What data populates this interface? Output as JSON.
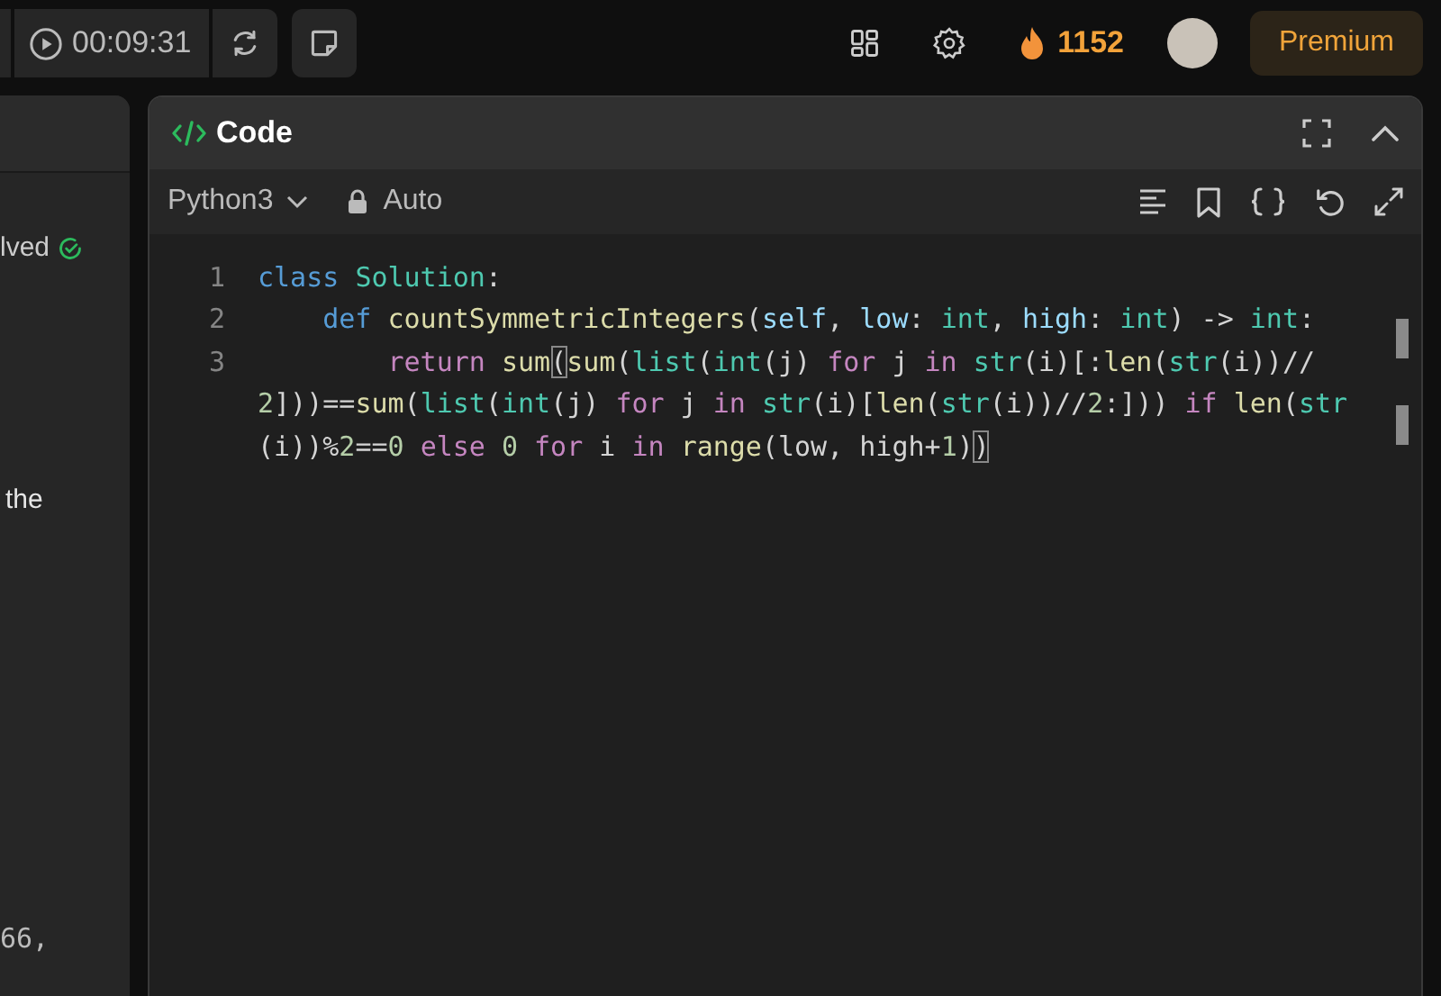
{
  "top_bar": {
    "timer": "00:09:31",
    "streak": "1152",
    "premium": "Premium"
  },
  "left_panel": {
    "texts": [
      {
        "text": "lved",
        "kind": "status"
      },
      {
        "text": "the",
        "kind": "prose"
      },
      {
        "text": "66,",
        "kind": "code"
      }
    ]
  },
  "code_panel": {
    "title": "Code",
    "language": "Python3",
    "mode": "Auto",
    "rows": [
      {
        "number": "1",
        "tokens": [
          {
            "kind": "kw",
            "text": "class "
          },
          {
            "kind": "ty",
            "text": "Solution"
          },
          {
            "kind": "p",
            "text": ":"
          }
        ]
      },
      {
        "number": "2",
        "tokens": [
          {
            "kind": "kw",
            "text": "    def "
          },
          {
            "kind": "fn",
            "text": "countSymmetricIntegers"
          },
          {
            "kind": "p",
            "text": "("
          },
          {
            "kind": "var",
            "text": "self"
          },
          {
            "kind": "p",
            "text": ", "
          },
          {
            "kind": "var",
            "text": "low"
          },
          {
            "kind": "p",
            "text": ": "
          },
          {
            "kind": "ty",
            "text": "int"
          },
          {
            "kind": "p",
            "text": ", "
          },
          {
            "kind": "var",
            "text": "high"
          },
          {
            "kind": "p",
            "text": ": "
          },
          {
            "kind": "ty",
            "text": "int"
          },
          {
            "kind": "p",
            "text": ") -> "
          },
          {
            "kind": "ty",
            "text": "int"
          },
          {
            "kind": "p",
            "text": ":"
          }
        ]
      },
      {
        "number": "3",
        "tokens": [
          {
            "kind": "ctl",
            "text": "        return "
          },
          {
            "kind": "fn",
            "text": "sum"
          },
          {
            "kind": "match",
            "text": "("
          },
          {
            "kind": "fn",
            "text": "sum"
          },
          {
            "kind": "p",
            "text": "("
          },
          {
            "kind": "ty",
            "text": "list"
          },
          {
            "kind": "p",
            "text": "("
          },
          {
            "kind": "ty",
            "text": "int"
          },
          {
            "kind": "p",
            "text": "(j) "
          },
          {
            "kind": "ctl",
            "text": "for"
          },
          {
            "kind": "p",
            "text": " j "
          },
          {
            "kind": "ctl",
            "text": "in "
          },
          {
            "kind": "ty",
            "text": "str"
          },
          {
            "kind": "p",
            "text": "(i)[:"
          },
          {
            "kind": "fn",
            "text": "len"
          },
          {
            "kind": "p",
            "text": "("
          },
          {
            "kind": "ty",
            "text": "str"
          },
          {
            "kind": "p",
            "text": "(i))//"
          }
        ]
      },
      {
        "tokens": [
          {
            "kind": "num",
            "text": "2"
          },
          {
            "kind": "p",
            "text": "]))=="
          },
          {
            "kind": "fn",
            "text": "sum"
          },
          {
            "kind": "p",
            "text": "("
          },
          {
            "kind": "ty",
            "text": "list"
          },
          {
            "kind": "p",
            "text": "("
          },
          {
            "kind": "ty",
            "text": "int"
          },
          {
            "kind": "p",
            "text": "(j) "
          },
          {
            "kind": "ctl",
            "text": "for"
          },
          {
            "kind": "p",
            "text": " j "
          },
          {
            "kind": "ctl",
            "text": "in "
          },
          {
            "kind": "ty",
            "text": "str"
          },
          {
            "kind": "p",
            "text": "(i)["
          },
          {
            "kind": "fn",
            "text": "len"
          },
          {
            "kind": "p",
            "text": "("
          },
          {
            "kind": "ty",
            "text": "str"
          },
          {
            "kind": "p",
            "text": "(i))//"
          },
          {
            "kind": "num",
            "text": "2"
          },
          {
            "kind": "p",
            "text": ":])) "
          },
          {
            "kind": "ctl",
            "text": "if "
          },
          {
            "kind": "fn",
            "text": "len"
          },
          {
            "kind": "p",
            "text": "("
          },
          {
            "kind": "ty",
            "text": "str"
          }
        ]
      },
      {
        "tokens": [
          {
            "kind": "p",
            "text": "(i))%"
          },
          {
            "kind": "num",
            "text": "2"
          },
          {
            "kind": "p",
            "text": "=="
          },
          {
            "kind": "num",
            "text": "0 "
          },
          {
            "kind": "ctl",
            "text": "else "
          },
          {
            "kind": "num",
            "text": "0 "
          },
          {
            "kind": "ctl",
            "text": "for"
          },
          {
            "kind": "p",
            "text": " i "
          },
          {
            "kind": "ctl",
            "text": "in "
          },
          {
            "kind": "fn",
            "text": "range"
          },
          {
            "kind": "p",
            "text": "(low, high+"
          },
          {
            "kind": "num",
            "text": "1"
          },
          {
            "kind": "p",
            "text": ")"
          },
          {
            "kind": "match",
            "text": ")"
          }
        ]
      }
    ]
  }
}
